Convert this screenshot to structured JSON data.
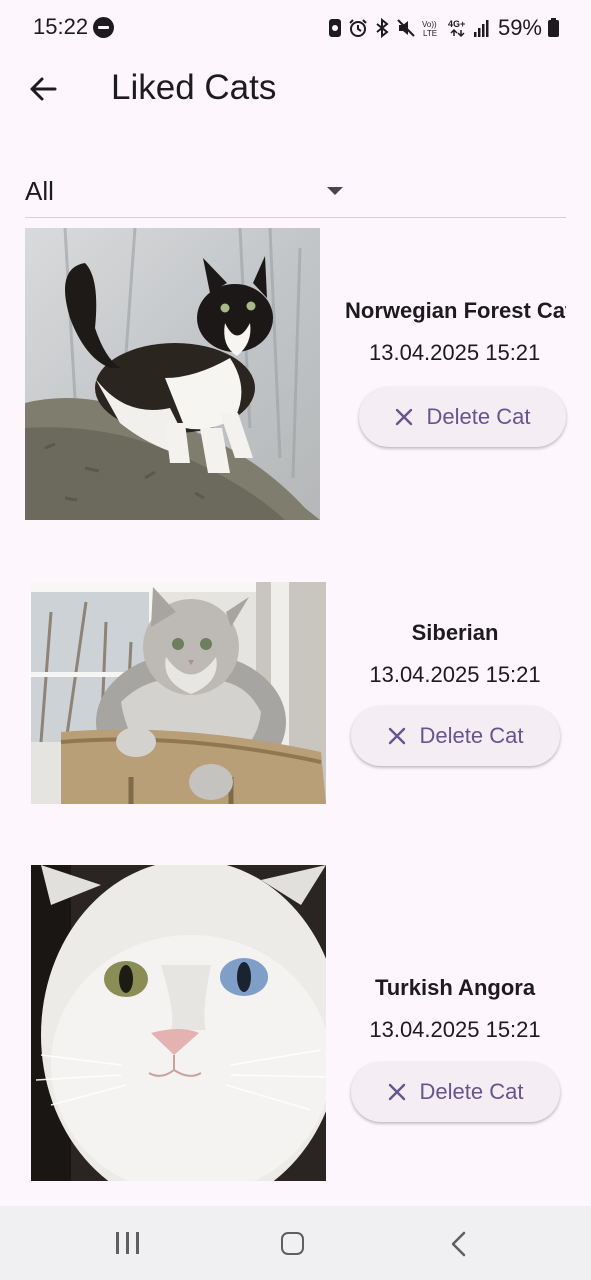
{
  "status_bar": {
    "time": "15:22",
    "battery": "59%",
    "icons": [
      "dnd-icon",
      "data-saver-icon",
      "alarm-icon",
      "bluetooth-icon",
      "mute-icon",
      "volte-icon",
      "4g-plus-icon",
      "signal-icon",
      "battery-icon"
    ]
  },
  "app_bar": {
    "title": "Liked Cats",
    "back_icon": "arrow-back-icon"
  },
  "filter": {
    "selected": "All"
  },
  "cats": [
    {
      "name": "Norwegian Forest Cat",
      "date": "13.04.2025 15:21",
      "delete_label": "Delete Cat"
    },
    {
      "name": "Siberian",
      "date": "13.04.2025 15:21",
      "delete_label": "Delete Cat"
    },
    {
      "name": "Turkish Angora",
      "date": "13.04.2025 15:21",
      "delete_label": "Delete Cat"
    }
  ],
  "colors": {
    "background": "#fdf7fd",
    "accent": "#65558f",
    "button_bg": "#f4edf4",
    "text": "#1d1b20"
  }
}
